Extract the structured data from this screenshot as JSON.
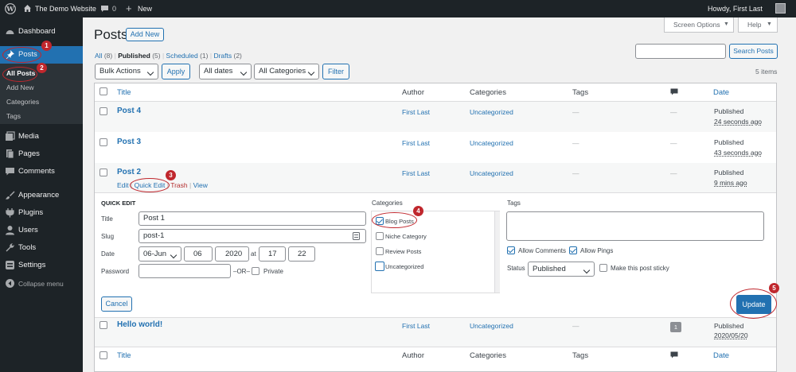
{
  "adminbar": {
    "site_name": "The Demo Website",
    "comments_count": "0",
    "new_label": "New",
    "howdy": "Howdy, First Last"
  },
  "sidebar": {
    "items": [
      {
        "label": "Dashboard",
        "icon": "dashboard-icon"
      },
      {
        "label": "Posts",
        "icon": "pushpin-icon"
      },
      {
        "label": "Media",
        "icon": "media-icon"
      },
      {
        "label": "Pages",
        "icon": "pages-icon"
      },
      {
        "label": "Comments",
        "icon": "comment-icon"
      },
      {
        "label": "Appearance",
        "icon": "brush-icon"
      },
      {
        "label": "Plugins",
        "icon": "plug-icon"
      },
      {
        "label": "Users",
        "icon": "user-icon"
      },
      {
        "label": "Tools",
        "icon": "wrench-icon"
      },
      {
        "label": "Settings",
        "icon": "settings-icon"
      },
      {
        "label": "Collapse menu",
        "icon": "collapse-icon"
      }
    ],
    "submenu": [
      "All Posts",
      "Add New",
      "Categories",
      "Tags"
    ]
  },
  "header": {
    "title": "Posts",
    "add_new": "Add New",
    "screen_options": "Screen Options",
    "help": "Help"
  },
  "views": {
    "all": "All",
    "all_count": "(8)",
    "published": "Published",
    "published_count": "(5)",
    "scheduled": "Scheduled",
    "scheduled_count": "(1)",
    "drafts": "Drafts",
    "drafts_count": "(2)",
    "sep": "|"
  },
  "search": {
    "value": "",
    "button": "Search Posts"
  },
  "filters": {
    "bulk_actions": "Bulk Actions",
    "apply": "Apply",
    "dates": "All dates",
    "categories": "All Categories",
    "filter": "Filter",
    "item_count": "5 items"
  },
  "table": {
    "columns": {
      "title": "Title",
      "author": "Author",
      "categories": "Categories",
      "tags": "Tags",
      "date": "Date"
    },
    "rows": [
      {
        "title": "Post 4",
        "author": "First Last",
        "category": "Uncategorized",
        "tags": "—",
        "comments": "—",
        "status": "Published",
        "date": "24 seconds ago"
      },
      {
        "title": "Post 3",
        "author": "First Last",
        "category": "Uncategorized",
        "tags": "—",
        "comments": "—",
        "status": "Published",
        "date": "43 seconds ago"
      },
      {
        "title": "Post 2",
        "author": "First Last",
        "category": "Uncategorized",
        "tags": "—",
        "comments": "—",
        "status": "Published",
        "date": "9 mins ago"
      },
      {
        "title": "Hello world!",
        "author": "First Last",
        "category": "Uncategorized",
        "tags": "—",
        "comments": "1",
        "status": "Published",
        "date": "2020/05/20"
      }
    ],
    "row_actions": {
      "edit": "Edit",
      "quick_edit": "Quick Edit",
      "trash": "Trash",
      "view": "View",
      "sep": "|"
    }
  },
  "quick_edit": {
    "heading": "QUICK EDIT",
    "title_label": "Title",
    "title_value": "Post 1",
    "slug_label": "Slug",
    "slug_value": "post-1",
    "date_label": "Date",
    "month": "06-Jun",
    "day": "06",
    "year": "2020",
    "at": "at",
    "hour": "17",
    "minute": "22",
    "password_label": "Password",
    "or_label": "–OR–",
    "private_label": "Private",
    "categories_label": "Categories",
    "categories": [
      {
        "label": "Blog Posts",
        "checked": true
      },
      {
        "label": "Niche Category",
        "checked": false
      },
      {
        "label": "Review Posts",
        "checked": false
      },
      {
        "label": "Uncategorized",
        "checked": false
      }
    ],
    "tags_label": "Tags",
    "allow_comments": "Allow Comments",
    "allow_pings": "Allow Pings",
    "status_label": "Status",
    "status_value": "Published",
    "sticky_label": "Make this post sticky",
    "cancel": "Cancel",
    "update": "Update"
  },
  "annotations": [
    "1",
    "2",
    "3",
    "4",
    "5"
  ],
  "colors": {
    "accent": "#2271b1",
    "sidebar": "#1d2327",
    "annotation": "#c0272d"
  }
}
